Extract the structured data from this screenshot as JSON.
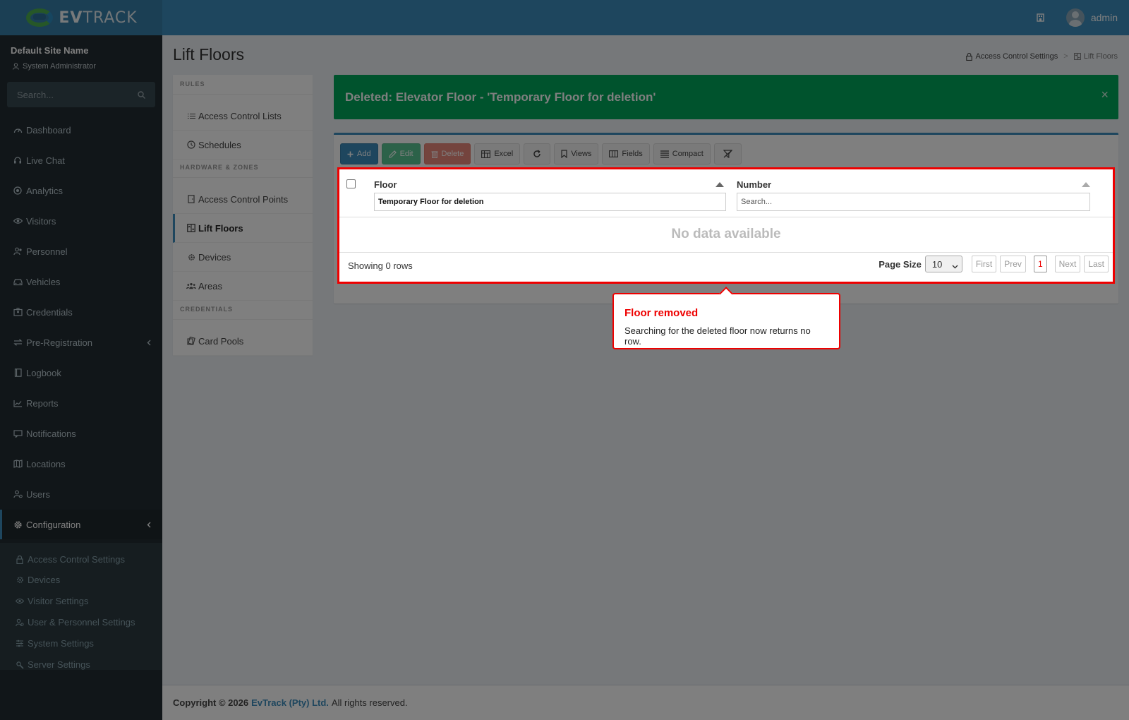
{
  "header": {
    "logo_text_bold": "EV",
    "logo_text": "TRACK",
    "user_name": "admin"
  },
  "sidebar": {
    "site_name": "Default Site Name",
    "role": "System Administrator",
    "search_placeholder": "Search...",
    "items": [
      {
        "label": "Dashboard",
        "icon": "dashboard-icon"
      },
      {
        "label": "Live Chat",
        "icon": "headset-icon"
      },
      {
        "label": "Analytics",
        "icon": "target-icon"
      },
      {
        "label": "Visitors",
        "icon": "eye-icon"
      },
      {
        "label": "Personnel",
        "icon": "user-group-icon"
      },
      {
        "label": "Vehicles",
        "icon": "car-icon"
      },
      {
        "label": "Credentials",
        "icon": "id-card-icon"
      },
      {
        "label": "Pre-Registration",
        "icon": "swap-icon"
      },
      {
        "label": "Logbook",
        "icon": "book-icon"
      },
      {
        "label": "Reports",
        "icon": "chart-icon"
      },
      {
        "label": "Notifications",
        "icon": "message-icon"
      },
      {
        "label": "Locations",
        "icon": "map-icon"
      },
      {
        "label": "Users",
        "icon": "users-icon"
      },
      {
        "label": "Configuration",
        "icon": "gear-icon"
      }
    ],
    "sub_items": [
      {
        "label": "Access Control Settings",
        "icon": "lock-icon"
      },
      {
        "label": "Devices",
        "icon": "chip-icon"
      },
      {
        "label": "Visitor Settings",
        "icon": "eye-icon"
      },
      {
        "label": "User & Personnel Settings",
        "icon": "user-gear-icon"
      },
      {
        "label": "System Settings",
        "icon": "sliders-icon"
      },
      {
        "label": "Server Settings",
        "icon": "wrench-icon"
      }
    ]
  },
  "page": {
    "title": "Lift Floors",
    "breadcrumb": [
      "Access Control Settings",
      "Lift Floors"
    ]
  },
  "settings_nav": {
    "sections": [
      {
        "header": "RULES",
        "items": [
          "Access Control Lists",
          "Schedules"
        ]
      },
      {
        "header": "HARDWARE & ZONES",
        "items": [
          "Access Control Points",
          "Lift Floors",
          "Devices",
          "Areas"
        ]
      },
      {
        "header": "CREDENTIALS",
        "items": [
          "Card Pools"
        ]
      }
    ]
  },
  "alert": {
    "text": "Deleted: Elevator Floor - 'Temporary Floor for deletion'",
    "close": "×"
  },
  "toolbar": {
    "add": "Add",
    "edit": "Edit",
    "delete": "Delete",
    "excel": "Excel",
    "views": "Views",
    "fields": "Fields",
    "compact": "Compact"
  },
  "grid": {
    "columns": [
      "Floor",
      "Number"
    ],
    "floor_filter_value": "Temporary Floor for deletion",
    "number_filter_placeholder": "Search...",
    "no_data": "No data available",
    "showing": "Showing 0 rows",
    "page_size_label": "Page Size",
    "page_size": "10",
    "pager": {
      "first": "First",
      "prev": "Prev",
      "current": "1",
      "next": "Next",
      "last": "Last"
    }
  },
  "callout": {
    "title": "Floor removed",
    "text": "Searching for the deleted floor now returns no row."
  },
  "footer": {
    "prefix": "Copyright © 2026",
    "company": "EvTrack (Pty) Ltd.",
    "suffix": "All rights reserved."
  }
}
